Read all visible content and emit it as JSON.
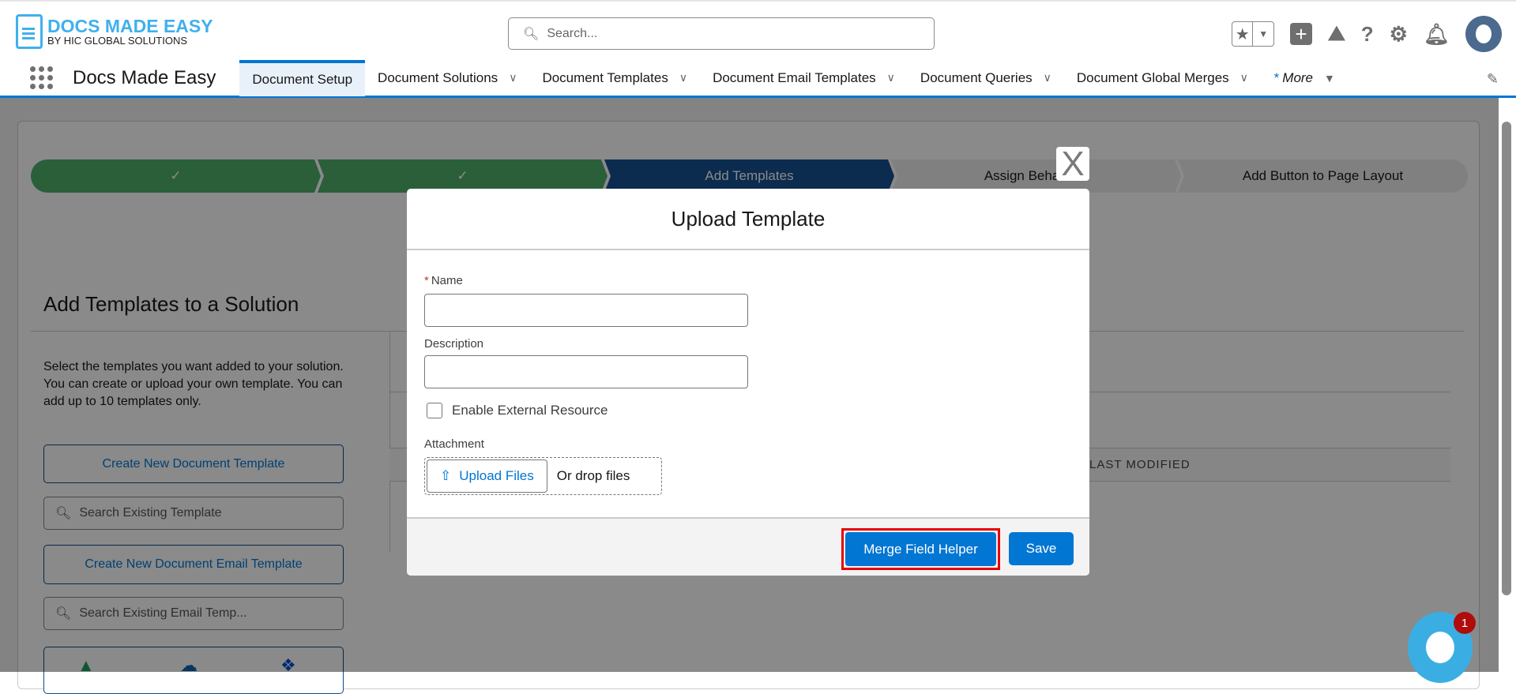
{
  "header": {
    "logo_title": "DOCS MADE EASY",
    "logo_subtitle": "BY HIC GLOBAL SOLUTIONS",
    "search_placeholder": "Search..."
  },
  "nav": {
    "app_name": "Docs Made Easy",
    "tabs": [
      {
        "label": "Document Setup"
      },
      {
        "label": "Document Solutions"
      },
      {
        "label": "Document Templates"
      },
      {
        "label": "Document Email Templates"
      },
      {
        "label": "Document Queries"
      },
      {
        "label": "Document Global Merges"
      }
    ],
    "more_label": "More",
    "more_marker": "*"
  },
  "path": {
    "steps": [
      {
        "label": "✓"
      },
      {
        "label": "✓"
      },
      {
        "label": "Add Templates"
      },
      {
        "label": "Assign Behaviors"
      },
      {
        "label": "Add Button to Page Layout"
      }
    ]
  },
  "left": {
    "title": "Add Templates to a Solution",
    "description": "Select the templates you want added to your solution. You can create or upload your own template. You can add up to 10 templates only.",
    "create_template": "Create New Document Template",
    "search_template_placeholder": "Search Existing Template",
    "create_email_template": "Create New Document Email Template",
    "search_email_placeholder": "Search Existing Email Temp..."
  },
  "table": {
    "last_modified_header": "LAST MODIFIED"
  },
  "modal": {
    "title": "Upload Template",
    "close": "X",
    "name_label": "Name",
    "required_marker": "*",
    "name_value": "",
    "description_label": "Description",
    "description_value": "",
    "enable_external_label": "Enable External Resource",
    "enable_external_checked": false,
    "attachment_label": "Attachment",
    "upload_files": "Upload Files",
    "drop_files": "Or drop files",
    "merge_field_helper": "Merge Field Helper",
    "save": "Save"
  },
  "chat": {
    "badge_count": "1"
  }
}
